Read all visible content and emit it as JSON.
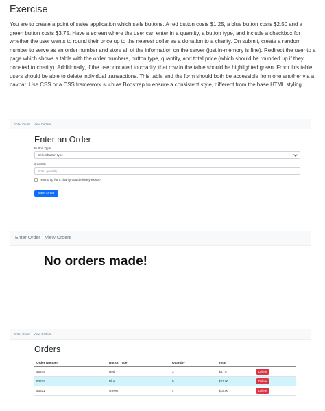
{
  "exercise": {
    "title": "Exercise",
    "text": "You are to create a point of sales application which sells buttons. A red button costs $1.25, a blue button costs $2.50 and a green button costs $3.75. Have a screen where the user can enter in a quantity, a button type, and include a checkbox for whether the user wants to round their price up to the nearest dollar as a donation to a charity. On submit, create a random number to serve as an order number and store all of the information on the server (just in-memory is fine). Redirect the user to a page which shows a table with the order numbers, button type, quantity, and total price (which should be rounded up if they donated to charity). Additionally, if the user donated to charity, that row in the table should be highlighted green. From this table, users should be able to delete individual transactions. This table and the form should both be accessible from one another via a navbar. Use CSS or a CSS framework such as Boostrap to ensure a consistent style, different from the base HTML styling."
  },
  "navbar": {
    "enter_order": "Enter Order",
    "view_orders": "View Orders"
  },
  "order_form": {
    "heading": "Enter an Order",
    "button_type_label": "Button Type",
    "button_type_selected": "Select button type",
    "quantity_label": "Quantity",
    "quantity_placeholder": "Enter quantity",
    "charity_label": "Round up for a charity that definitely exists?",
    "charity_checked": false,
    "submit_label": "Save Order"
  },
  "empty_orders": {
    "message": "No orders made!"
  },
  "orders": {
    "heading": "Orders",
    "columns": [
      "Order Number",
      "Button Type",
      "Quantity",
      "Total"
    ],
    "delete_label": "Delete",
    "rows": [
      {
        "order_number": "45245",
        "button_type": "Red",
        "quantity": "3",
        "total": "$3.75",
        "charity": false
      },
      {
        "order_number": "53279",
        "button_type": "Blue",
        "quantity": "9",
        "total": "$23.00",
        "charity": true
      },
      {
        "order_number": "53811",
        "button_type": "Green",
        "quantity": "4",
        "total": "$15.00",
        "charity": false
      }
    ]
  },
  "colors": {
    "primary": "#0d6efd",
    "danger": "#dc3545",
    "highlight_row": "#cff4fc",
    "navbar_bg": "#f8f9fa"
  }
}
